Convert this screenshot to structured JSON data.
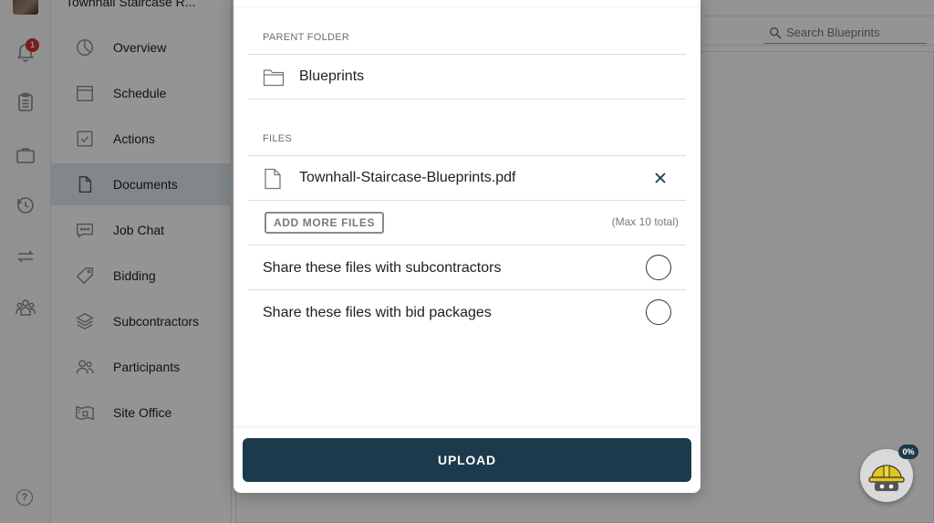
{
  "project": {
    "title": "Townhall Staircase R..."
  },
  "rail": {
    "notification_count": "1",
    "icons": [
      "bell-icon",
      "clipboard-icon",
      "briefcase-icon",
      "history-icon",
      "transfer-icon",
      "team-icon"
    ],
    "help_label": "?"
  },
  "sidenav": {
    "items": [
      {
        "label": "Overview",
        "icon": "pie-chart-icon"
      },
      {
        "label": "Schedule",
        "icon": "calendar-icon"
      },
      {
        "label": "Actions",
        "icon": "checkbox-icon"
      },
      {
        "label": "Documents",
        "icon": "document-icon",
        "active": true
      },
      {
        "label": "Job Chat",
        "icon": "chat-icon"
      },
      {
        "label": "Bidding",
        "icon": "tag-icon"
      },
      {
        "label": "Subcontractors",
        "icon": "layers-icon"
      },
      {
        "label": "Participants",
        "icon": "people-icon"
      },
      {
        "label": "Site Office",
        "icon": "site-office-icon"
      }
    ]
  },
  "search": {
    "placeholder": "Search Blueprints"
  },
  "modal": {
    "parent_folder_label": "PARENT FOLDER",
    "parent_folder_name": "Blueprints",
    "files_label": "FILES",
    "files": [
      {
        "name": "Townhall-Staircase-Blueprints.pdf"
      }
    ],
    "add_more_label": "ADD MORE FILES",
    "max_note": "(Max 10 total)",
    "share_subcontractors_label": "Share these files with subcontractors",
    "share_bid_packages_label": "Share these files with bid packages",
    "upload_label": "UPLOAD"
  },
  "helper": {
    "progress": "0%"
  },
  "colors": {
    "primary": "#1b3a4b",
    "badge": "#d0342c",
    "active_nav": "#dfe8ee"
  }
}
